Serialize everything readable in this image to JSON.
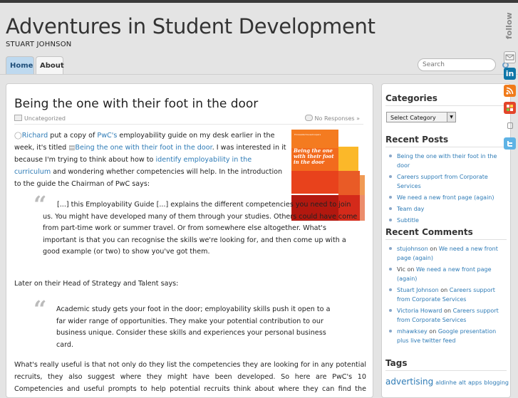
{
  "site": {
    "title": "Adventures in Student Development",
    "description": "STUART JOHNSON"
  },
  "nav": {
    "home": "Home",
    "about": "About"
  },
  "search": {
    "placeholder": "Search"
  },
  "follow": {
    "label": "follow"
  },
  "post": {
    "title": "Being the one with their foot in the door",
    "category": "Uncategorized",
    "responses": "No Responses »",
    "para1": {
      "author_link": "Richard",
      "t1": " put a copy of ",
      "pwc_link": "PwC's",
      "t2": " employability guide on my desk earlier in the week, it's titled ",
      "guide_link": "Being the one with their foot in the door",
      "t3": ". I was interested in it because I'm trying to think about how to ",
      "curriculum_link": "identify employability in the curriculum",
      "t4": " and wondering whether competencies will help. In the introduction to the guide the Chairman of PwC says:"
    },
    "quote1": "[...] this Employability Guide [...] explains the different competencies you need to join us. You might have developed many of them through your studies. Others could have come from part-time work or summer travel. Or from somewhere else altogether. What's important is that you can recognise the skills we're looking for, and then come up with a good example (or two) to show you've got them.",
    "para2": "Later on their Head of Strategy and Talent says:",
    "quote2": "Academic study gets your foot in the door; employability skills push it open to a far wider range of opportunities. They make your potential contribution to our business unique. Consider these skills and experiences your personal business card.",
    "para3": "What's really useful is that not only do they list the competencies they are looking for in any potential recruits, they also suggest where they might have been developed. So here are PwC's 10 Competencies and useful prompts to help potential recruits think about where they can find the evidence for these and identify any",
    "cover_text": "Being the one with their foot in the door",
    "cover_small": "PricewaterhouseCoopers"
  },
  "sidebar": {
    "categories_title": "Categories",
    "select_value": "Select Category",
    "recent_posts_title": "Recent Posts",
    "recent_posts": [
      "Being the one with their foot in the door",
      "Careers support from Corporate Services",
      "We need a new front page (again)",
      "Team day",
      "Subtitle"
    ],
    "recent_comments_title": "Recent Comments",
    "recent_comments": [
      {
        "author": "stujohnson",
        "on": " on ",
        "post": "We need a new front page (again)"
      },
      {
        "author": "Vic",
        "on": " on ",
        "post": "We need a new front page (again)"
      },
      {
        "author": "Stuart Johnson",
        "on": " on ",
        "post": "Careers support from Corporate Services"
      },
      {
        "author": "Victoria Howard",
        "on": " on ",
        "post": "Careers support from Corporate Services"
      },
      {
        "author": "mhawksey",
        "on": " on ",
        "post": "Google presentation plus live twitter feed"
      }
    ],
    "tags_title": "Tags",
    "tags": [
      "advertising",
      "aldinhe",
      "alt",
      "apps",
      "blogging"
    ]
  },
  "colors": {
    "link": "#2e7bb6",
    "home_tab": "#bed9ef",
    "cover_orange": "#f47b20",
    "cover_red": "#d93a1f"
  }
}
